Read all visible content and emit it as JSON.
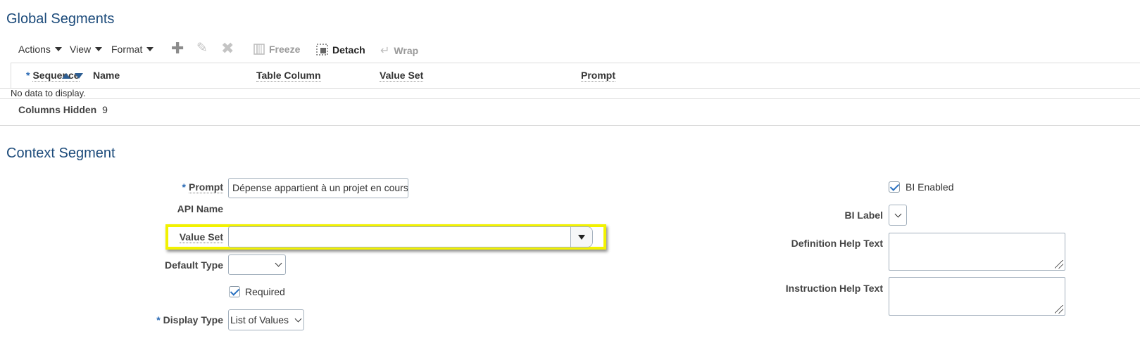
{
  "global_segments": {
    "title": "Global Segments",
    "toolbar": {
      "actions_label": "Actions",
      "view_label": "View",
      "format_label": "Format",
      "freeze_label": "Freeze",
      "detach_label": "Detach",
      "wrap_label": "Wrap"
    },
    "table": {
      "columns": [
        "Sequence",
        "Name",
        "Table Column",
        "Value Set",
        "Prompt"
      ],
      "required_marker": "*",
      "empty_message": "No data to display.",
      "columns_hidden_label": "Columns Hidden",
      "columns_hidden_count": "9"
    }
  },
  "context_segment": {
    "title": "Context Segment",
    "required_marker": "*",
    "prompt_label": "Prompt",
    "prompt_value": "Dépense appartient à un projet en cours",
    "api_name_label": "API Name",
    "value_set_label": "Value Set",
    "value_set_value": "",
    "default_type_label": "Default Type",
    "default_type_value": "",
    "required_label": "Required",
    "required_checked": true,
    "display_type_label": "Display Type",
    "display_type_value": "List of Values",
    "bi_enabled_label": "BI Enabled",
    "bi_enabled_checked": true,
    "bi_label_label": "BI Label",
    "definition_help_label": "Definition Help Text",
    "instruction_help_label": "Instruction Help Text"
  },
  "colors": {
    "title": "#1b4a7a",
    "required_star": "#2a6ab5",
    "highlight_border": "#f2f200",
    "checkmark": "#2b72c1"
  }
}
